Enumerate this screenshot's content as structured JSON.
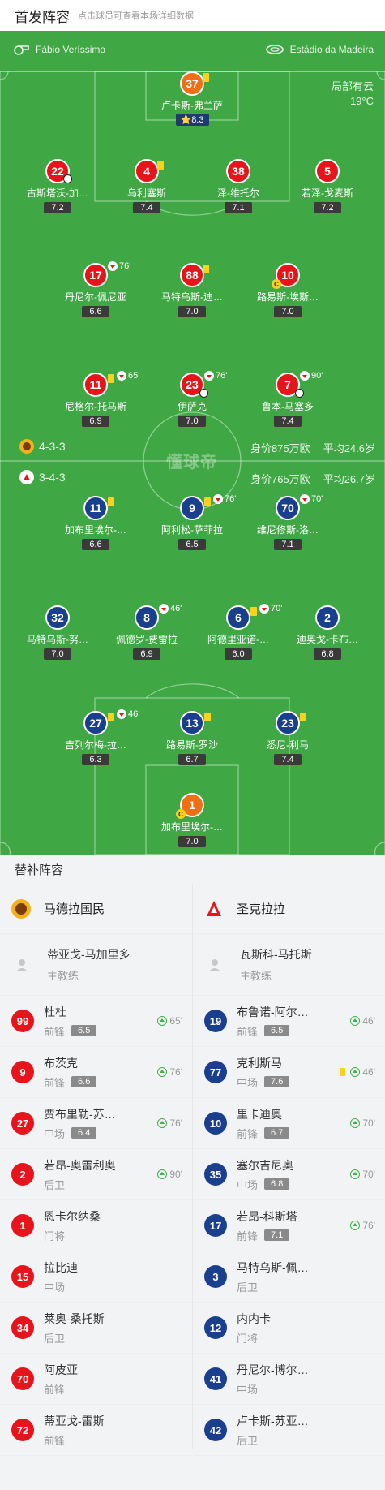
{
  "header": {
    "title": "首发阵容",
    "subtitle": "点击球员可查看本场详细数据"
  },
  "match": {
    "referee": "Fábio Veríssimo",
    "stadium": "Estádio da Madeira",
    "weather": "局部有云",
    "temperature": "19°C",
    "watermark": "懂球帝"
  },
  "home": {
    "name": "马德拉国民",
    "formation": "4-3-3",
    "value": "身价875万欧",
    "age": "平均24.6岁",
    "color": "#e8141c"
  },
  "away": {
    "name": "圣克拉拉",
    "formation": "3-4-3",
    "value": "身价765万欧",
    "age": "平均26.7岁",
    "color": "#1a3f8f"
  },
  "home_lineup": [
    {
      "num": "37",
      "name": "卢卡斯-弗兰萨",
      "rating": "8.3",
      "best": true,
      "gk": true,
      "yellow": true
    },
    {
      "num": "22",
      "name": "古斯塔沃-加…",
      "rating": "7.2",
      "ball": true
    },
    {
      "num": "4",
      "name": "乌利塞斯",
      "rating": "7.4",
      "yellow": true
    },
    {
      "num": "38",
      "name": "泽-维托尔",
      "rating": "7.1"
    },
    {
      "num": "5",
      "name": "若泽-戈麦斯",
      "rating": "7.2"
    },
    {
      "num": "17",
      "name": "丹尼尔-佩尼亚",
      "rating": "6.6",
      "sub_out": "76'"
    },
    {
      "num": "88",
      "name": "马特乌斯-迪…",
      "rating": "7.0",
      "yellow": true
    },
    {
      "num": "10",
      "name": "路易斯-埃斯…",
      "rating": "7.0",
      "captain": true
    },
    {
      "num": "11",
      "name": "尼格尔-托马斯",
      "rating": "6.9",
      "yellow": true,
      "sub_out": "65'"
    },
    {
      "num": "23",
      "name": "伊萨克",
      "rating": "7.0",
      "sub_out": "76'",
      "ball": true
    },
    {
      "num": "7",
      "name": "鲁本-马塞多",
      "rating": "7.4",
      "sub_out": "90'",
      "ball": true
    }
  ],
  "away_lineup": [
    {
      "num": "11",
      "name": "加布里埃尔-…",
      "rating": "6.6",
      "yellow": true
    },
    {
      "num": "9",
      "name": "阿利松-萨菲拉",
      "rating": "6.5",
      "yellow": true,
      "sub_out": "76'"
    },
    {
      "num": "70",
      "name": "维尼修斯-洛…",
      "rating": "7.1",
      "sub_out": "70'"
    },
    {
      "num": "32",
      "name": "马特乌斯-努…",
      "rating": "7.0"
    },
    {
      "num": "8",
      "name": "佩德罗-费雷拉",
      "rating": "6.9",
      "sub_out": "46'"
    },
    {
      "num": "6",
      "name": "阿德里亚诺-…",
      "rating": "6.0",
      "yellow": true,
      "sub_out": "70'"
    },
    {
      "num": "2",
      "name": "迪奥戈-卡布…",
      "rating": "6.8"
    },
    {
      "num": "27",
      "name": "吉列尔梅-拉…",
      "rating": "6.3",
      "yellow": true,
      "sub_out": "46'"
    },
    {
      "num": "13",
      "name": "路易斯-罗沙",
      "rating": "6.7",
      "yellow": true
    },
    {
      "num": "23",
      "name": "悉尼-利马",
      "rating": "7.4",
      "yellow": true
    },
    {
      "num": "1",
      "name": "加布里埃尔-…",
      "rating": "7.0",
      "gk": true,
      "captain": true
    }
  ],
  "subs": {
    "title": "替补阵容",
    "home_coach": {
      "name": "蒂亚戈-马加里多",
      "role": "主教练"
    },
    "away_coach": {
      "name": "瓦斯科-马托斯",
      "role": "主教练"
    },
    "home": [
      {
        "num": "99",
        "name": "杜杜",
        "pos": "前锋",
        "rating": "6.5",
        "minute": "65'"
      },
      {
        "num": "9",
        "name": "布茨克",
        "pos": "前锋",
        "rating": "6.6",
        "minute": "76'"
      },
      {
        "num": "27",
        "name": "贾布里勒-苏…",
        "pos": "中场",
        "rating": "6.4",
        "minute": "76'"
      },
      {
        "num": "2",
        "name": "若昂-奥雷利奥",
        "pos": "后卫",
        "rating": "",
        "minute": "90'"
      },
      {
        "num": "1",
        "name": "恩卡尔纳桑",
        "pos": "门将",
        "rating": "",
        "minute": ""
      },
      {
        "num": "15",
        "name": "拉比迪",
        "pos": "中场",
        "rating": "",
        "minute": ""
      },
      {
        "num": "34",
        "name": "莱奥-桑托斯",
        "pos": "后卫",
        "rating": "",
        "minute": ""
      },
      {
        "num": "70",
        "name": "阿皮亚",
        "pos": "前锋",
        "rating": "",
        "minute": ""
      },
      {
        "num": "72",
        "name": "蒂亚戈-雷斯",
        "pos": "前锋",
        "rating": "",
        "minute": ""
      }
    ],
    "away": [
      {
        "num": "19",
        "name": "布鲁诺-阿尔…",
        "pos": "前锋",
        "rating": "6.5",
        "minute": "46'"
      },
      {
        "num": "77",
        "name": "克利斯马",
        "pos": "中场",
        "rating": "7.6",
        "minute": "46'",
        "yellow": true
      },
      {
        "num": "10",
        "name": "里卡迪奥",
        "pos": "前锋",
        "rating": "6.7",
        "minute": "70'"
      },
      {
        "num": "35",
        "name": "塞尔吉尼奥",
        "pos": "中场",
        "rating": "6.8",
        "minute": "70'"
      },
      {
        "num": "17",
        "name": "若昂-科斯塔",
        "pos": "前锋",
        "rating": "7.1",
        "minute": "76'"
      },
      {
        "num": "3",
        "name": "马特乌斯-佩…",
        "pos": "后卫",
        "rating": "",
        "minute": ""
      },
      {
        "num": "12",
        "name": "内内卡",
        "pos": "门将",
        "rating": "",
        "minute": ""
      },
      {
        "num": "41",
        "name": "丹尼尔-博尔…",
        "pos": "中场",
        "rating": "",
        "minute": ""
      },
      {
        "num": "42",
        "name": "卢卡斯-苏亚…",
        "pos": "后卫",
        "rating": "",
        "minute": ""
      }
    ]
  }
}
